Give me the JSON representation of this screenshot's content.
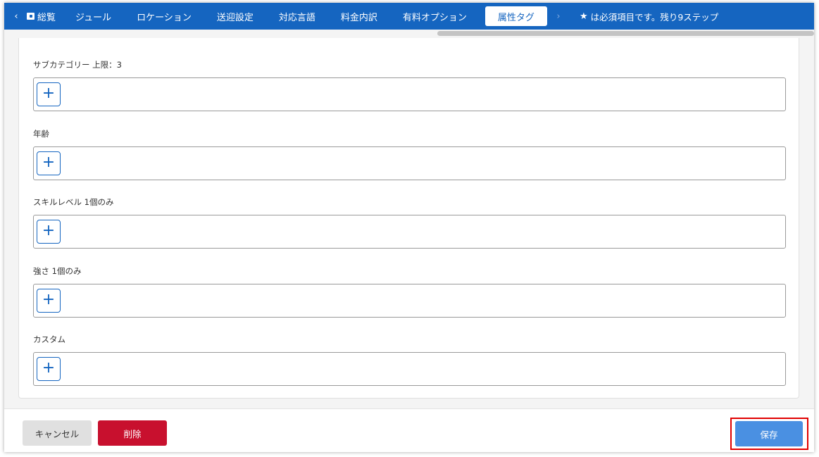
{
  "nav": {
    "prev_arrow": "‹",
    "next_arrow": "›",
    "tabs": [
      {
        "label": "総覧"
      },
      {
        "label": "ジュール"
      },
      {
        "label": "ロケーション"
      },
      {
        "label": "送迎設定"
      },
      {
        "label": "対応言語"
      },
      {
        "label": "料金内訳"
      },
      {
        "label": "有料オプション"
      },
      {
        "label": "属性タグ"
      }
    ],
    "active_tab": "属性タグ",
    "required_note_star": "★",
    "required_note": "は必須項目です。残り9ステップ"
  },
  "fields": [
    {
      "label": "サブカテゴリー 上限：3",
      "add_symbol": "+"
    },
    {
      "label": "年齢",
      "add_symbol": "+"
    },
    {
      "label": "スキルレベル 1個のみ",
      "add_symbol": "+"
    },
    {
      "label": "強さ 1個のみ",
      "add_symbol": "+"
    },
    {
      "label": "カスタム",
      "add_symbol": "+"
    }
  ],
  "footer": {
    "cancel_label": "キャンセル",
    "delete_label": "削除",
    "save_label": "保存"
  },
  "colors": {
    "nav_bg": "#1565c0",
    "delete_bg": "#c8102e",
    "save_bg": "#4a90e2",
    "highlight_border": "#e00000"
  }
}
